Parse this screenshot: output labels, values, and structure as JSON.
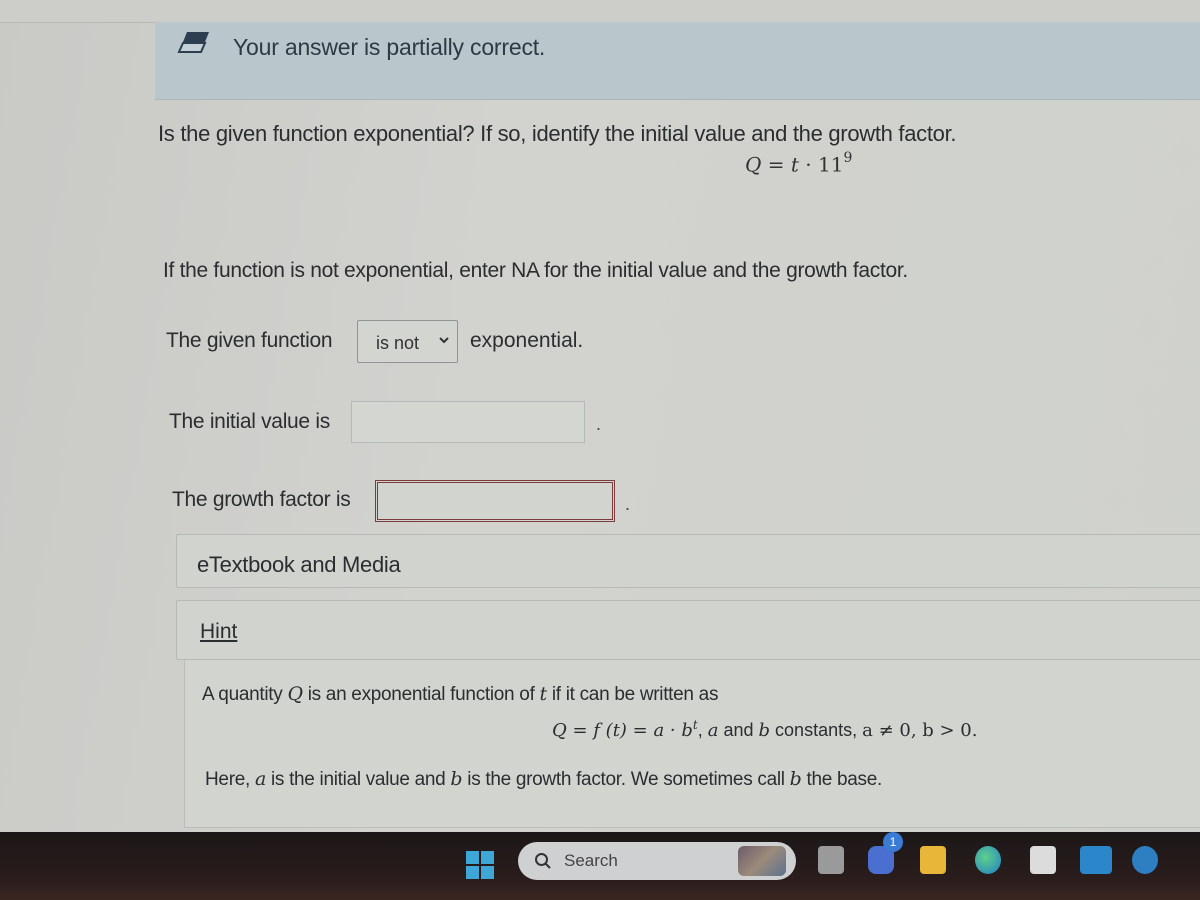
{
  "feedback": {
    "icon": "eraser-icon",
    "message": "Your answer is partially correct."
  },
  "question": {
    "prompt": "Is the given function exponential? If so, identify the initial value and the growth factor.",
    "formula": {
      "lhs": "Q",
      "eq": "=",
      "var": "t",
      "dot": "·",
      "base": "11",
      "exponent": "9"
    },
    "instruction": "If the function is not exponential, enter NA for the initial value and the growth factor."
  },
  "answers": {
    "function_label": "The given function",
    "function_select_value": "is not",
    "function_suffix": "exponential.",
    "initial_label": "The initial value is",
    "initial_value": "",
    "growth_label": "The growth factor is",
    "growth_value": "",
    "period": "."
  },
  "panels": {
    "media_label": "eTextbook and Media",
    "hint_label": "Hint"
  },
  "hint": {
    "line1_a": "A quantity ",
    "line1_Q": "Q",
    "line1_b": " is an exponential function of ",
    "line1_t": "t",
    "line1_c": " if it can be written as",
    "line2_formula": "Q = f (t) = a · b",
    "line2_exp": "t",
    "line2_comma": ", ",
    "line2_a": "a",
    "line2_and": " and ",
    "line2_b": "b",
    "line2_constants": " constants, ",
    "line2_cond": "a ≠ 0,  b > 0.",
    "line3_a": "Here, ",
    "line3_avar": "a",
    "line3_b": " is the initial value and ",
    "line3_bvar": "b",
    "line3_c": " is the growth factor. We sometimes call ",
    "line3_bvar2": "b",
    "line3_d": " the base."
  },
  "taskbar": {
    "search_placeholder": "Search",
    "teams_badge": "1",
    "apps": [
      "windows-start",
      "search",
      "task-view",
      "teams-chat",
      "file-explorer",
      "edge",
      "microsoft-store",
      "myhp",
      "get-help"
    ]
  }
}
